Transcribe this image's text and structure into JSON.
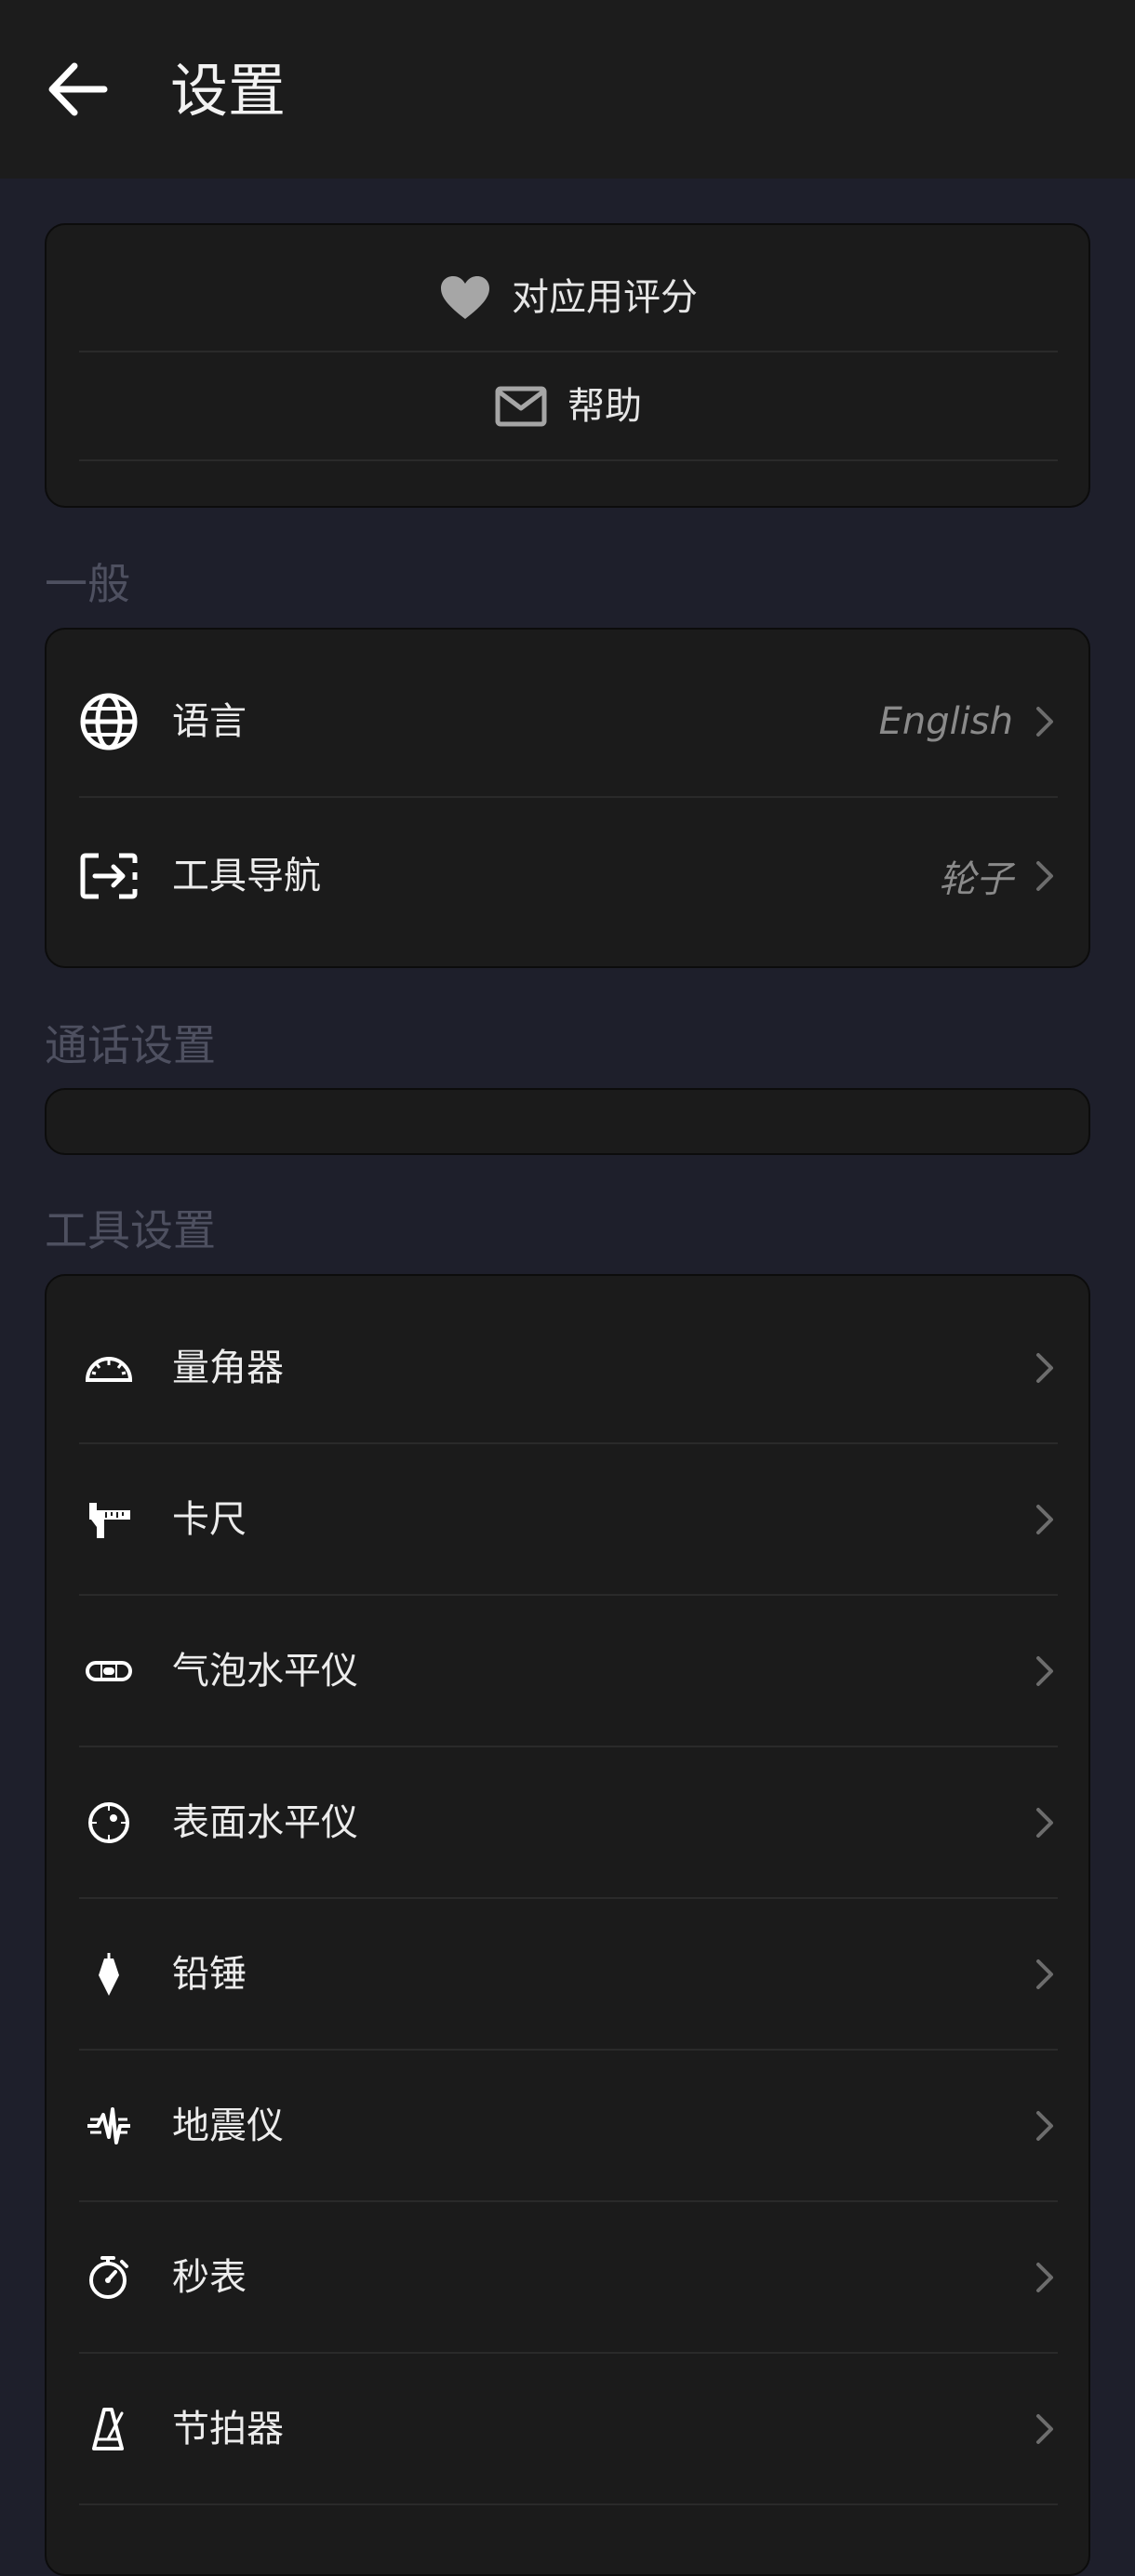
{
  "header": {
    "title": "设置",
    "back_icon": "arrow-left-icon"
  },
  "top_card": {
    "items": [
      {
        "label": "对应用评分",
        "icon": "heart-icon"
      },
      {
        "label": "帮助",
        "icon": "mail-icon"
      }
    ]
  },
  "general": {
    "title": "一般",
    "items": [
      {
        "label": "语言",
        "value": "English",
        "icon": "globe-icon"
      },
      {
        "label": "工具导航",
        "value": "轮子",
        "icon": "tool-navigation-icon"
      }
    ]
  },
  "call": {
    "title": "通话设置"
  },
  "tools": {
    "title": "工具设置",
    "items": [
      {
        "label": "量角器",
        "icon": "protractor-icon"
      },
      {
        "label": "卡尺",
        "icon": "caliper-icon"
      },
      {
        "label": "气泡水平仪",
        "icon": "bubble-level-icon"
      },
      {
        "label": "表面水平仪",
        "icon": "surface-level-icon"
      },
      {
        "label": "铅锤",
        "icon": "plumb-bob-icon"
      },
      {
        "label": "地震仪",
        "icon": "seismometer-icon"
      },
      {
        "label": "秒表",
        "icon": "stopwatch-icon"
      },
      {
        "label": "节拍器",
        "icon": "metronome-icon"
      }
    ]
  },
  "colors": {
    "background": "#1e1f2b",
    "appbar": "#1c1c1c",
    "card": "#1b1b1b",
    "section_title": "#4e5060",
    "value_text": "#8a8a8a"
  }
}
